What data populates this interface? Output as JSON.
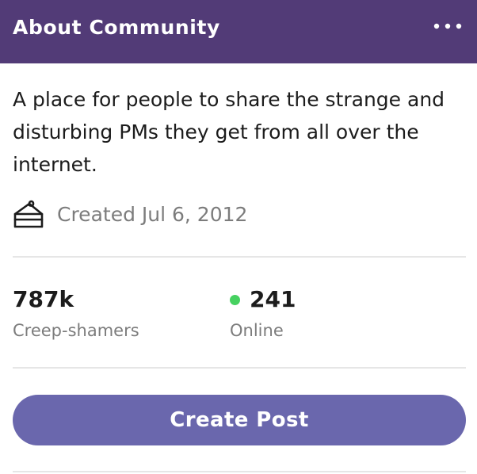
{
  "header": {
    "title": "About Community",
    "more_icon": "more-horizontal-icon"
  },
  "community": {
    "description": "A place for people to share the strange and disturbing PMs they get from all over the internet.",
    "created_icon": "cake-icon",
    "created_text": "Created Jul 6, 2012"
  },
  "stats": {
    "members_value": "787k",
    "members_label": "Creep-shamers",
    "online_value": "241",
    "online_label": "Online"
  },
  "actions": {
    "create_post_label": "Create Post"
  },
  "colors": {
    "header_bg": "#523b77",
    "button_bg": "#6a67ad",
    "online_dot": "#46d160",
    "muted_text": "#7c7c7c"
  }
}
